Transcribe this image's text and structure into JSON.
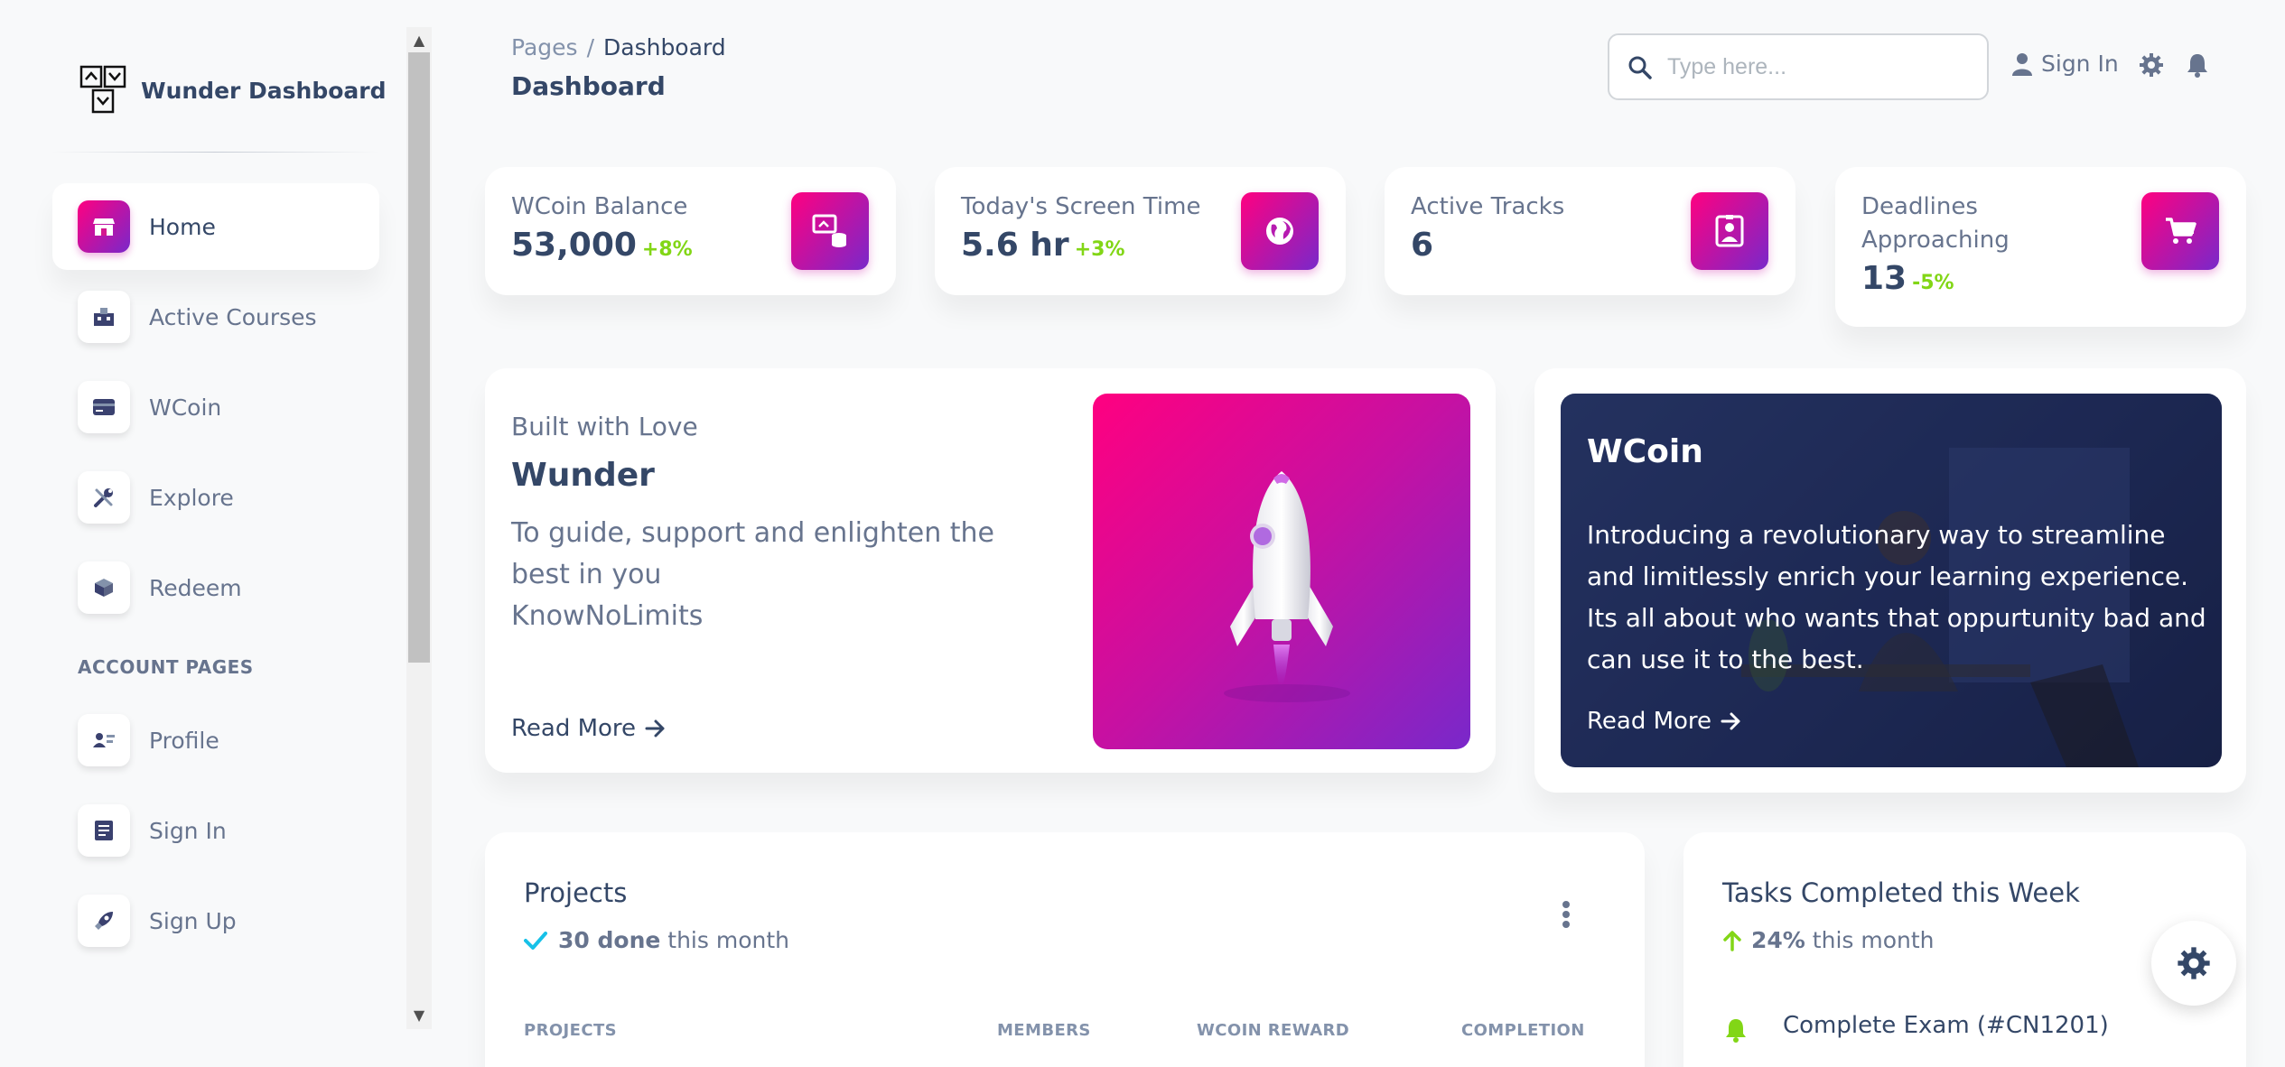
{
  "brand": {
    "name": "Wunder Dashboard"
  },
  "sidebar": {
    "items": [
      {
        "label": "Home",
        "icon": "shop-icon"
      },
      {
        "label": "Active Courses",
        "icon": "office-icon"
      },
      {
        "label": "WCoin",
        "icon": "credit-card-icon"
      },
      {
        "label": "Explore",
        "icon": "tools-icon"
      },
      {
        "label": "Redeem",
        "icon": "box-icon"
      }
    ],
    "section_title": "ACCOUNT PAGES",
    "account_items": [
      {
        "label": "Profile",
        "icon": "profile-icon"
      },
      {
        "label": "Sign In",
        "icon": "document-icon"
      },
      {
        "label": "Sign Up",
        "icon": "rocket-icon"
      }
    ]
  },
  "header": {
    "breadcrumb_root": "Pages",
    "breadcrumb_sep": "/",
    "breadcrumb_current": "Dashboard",
    "title": "Dashboard",
    "search_placeholder": "Type here...",
    "signin_label": "Sign In"
  },
  "stats": [
    {
      "label": "WCoin Balance",
      "value": "53,000",
      "change": "+8%",
      "icon": "coins-icon"
    },
    {
      "label": "Today's Screen Time",
      "value": "5.6 hr",
      "change": "+3%",
      "icon": "globe-icon"
    },
    {
      "label": "Active Tracks",
      "value": "6",
      "change": "",
      "icon": "badge-icon"
    },
    {
      "label_line1": "Deadlines",
      "label_line2": "Approaching",
      "value": "13",
      "change": "-5%",
      "icon": "cart-icon"
    }
  ],
  "love_card": {
    "subtitle": "Built with Love",
    "title": "Wunder",
    "desc_line1": "To guide, support and enlighten the",
    "desc_line2": "best in you",
    "desc_line3": "KnowNoLimits",
    "read_more": "Read More"
  },
  "wcoin_card": {
    "title": "WCoin",
    "desc": "Introducing a revolutionary way to streamline and limitlessly enrich your learning experience. Its all about who wants that oppurtunity bad and can use it to the best.",
    "read_more": "Read More"
  },
  "projects": {
    "title": "Projects",
    "done": "30 done",
    "period": "this month",
    "columns": [
      "PROJECTS",
      "MEMBERS",
      "WCOIN REWARD",
      "COMPLETION"
    ]
  },
  "tasks": {
    "title": "Tasks Completed this Week",
    "percent": "24%",
    "period": "this month",
    "first_item": "Complete Exam (#CN1201)"
  },
  "colors": {
    "accent_start": "#7928ca",
    "accent_end": "#ff0080",
    "positive": "#82d616",
    "text_dark": "#344767",
    "text_muted": "#67748e"
  }
}
